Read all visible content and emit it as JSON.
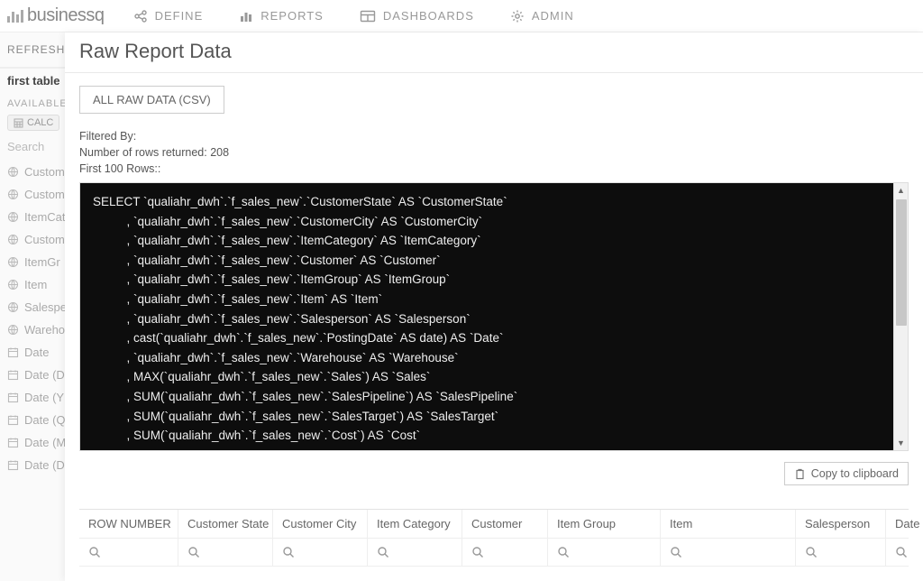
{
  "logo_text": "businessq",
  "nav": {
    "define": "DEFINE",
    "reports": "REPORTS",
    "dashboards": "DASHBOARDS",
    "admin": "ADMIN"
  },
  "sidebar": {
    "refresh": "REFRESH",
    "first_table": "first table",
    "available": "AVAILABLE",
    "calc": "CALC",
    "search_placeholder": "Search",
    "items": [
      "Custom",
      "Custom",
      "ItemCat",
      "Custom",
      "ItemGr",
      "Item",
      "Salespe",
      "Warehou",
      "Date",
      "Date (D",
      "Date (Y",
      "Date (Q",
      "Date (M",
      "Date (D"
    ]
  },
  "modal": {
    "title": "Raw Report Data",
    "csv_button": "ALL RAW DATA (CSV)",
    "filtered_by": "Filtered By:",
    "rows_returned": "Number of rows returned: 208",
    "first_rows": "First 100 Rows::",
    "copy_button": "Copy to clipboard",
    "sql": "SELECT `qualiahr_dwh`.`f_sales_new`.`CustomerState` AS `CustomerState`\n          , `qualiahr_dwh`.`f_sales_new`.`CustomerCity` AS `CustomerCity`\n          , `qualiahr_dwh`.`f_sales_new`.`ItemCategory` AS `ItemCategory`\n          , `qualiahr_dwh`.`f_sales_new`.`Customer` AS `Customer`\n          , `qualiahr_dwh`.`f_sales_new`.`ItemGroup` AS `ItemGroup`\n          , `qualiahr_dwh`.`f_sales_new`.`Item` AS `Item`\n          , `qualiahr_dwh`.`f_sales_new`.`Salesperson` AS `Salesperson`\n          , cast(`qualiahr_dwh`.`f_sales_new`.`PostingDate` AS date) AS `Date`\n          , `qualiahr_dwh`.`f_sales_new`.`Warehouse` AS `Warehouse`\n          , MAX(`qualiahr_dwh`.`f_sales_new`.`Sales`) AS `Sales`\n          , SUM(`qualiahr_dwh`.`f_sales_new`.`SalesPipeline`) AS `SalesPipeline`\n          , SUM(`qualiahr_dwh`.`f_sales_new`.`SalesTarget`) AS `SalesTarget`\n          , SUM(`qualiahr_dwh`.`f_sales_new`.`Cost`) AS `Cost`\n          , SUM(`qualiahr_dwh`.`f_sales_new`.`Profit`) AS `Profit`\n          , SUM(`qualiahr_dwh`.`f_sales_new`.`Discount`) AS `Discount`\n          , SUM(`qualiahr_dwh`.`f_sales_new`.`ActionDiscount`) AS `ActionDiscount`"
  },
  "table": {
    "columns": [
      "ROW NUMBER",
      "Customer State",
      "Customer City",
      "Item Category",
      "Customer",
      "Item Group",
      "Item",
      "Salesperson",
      "Date"
    ]
  }
}
